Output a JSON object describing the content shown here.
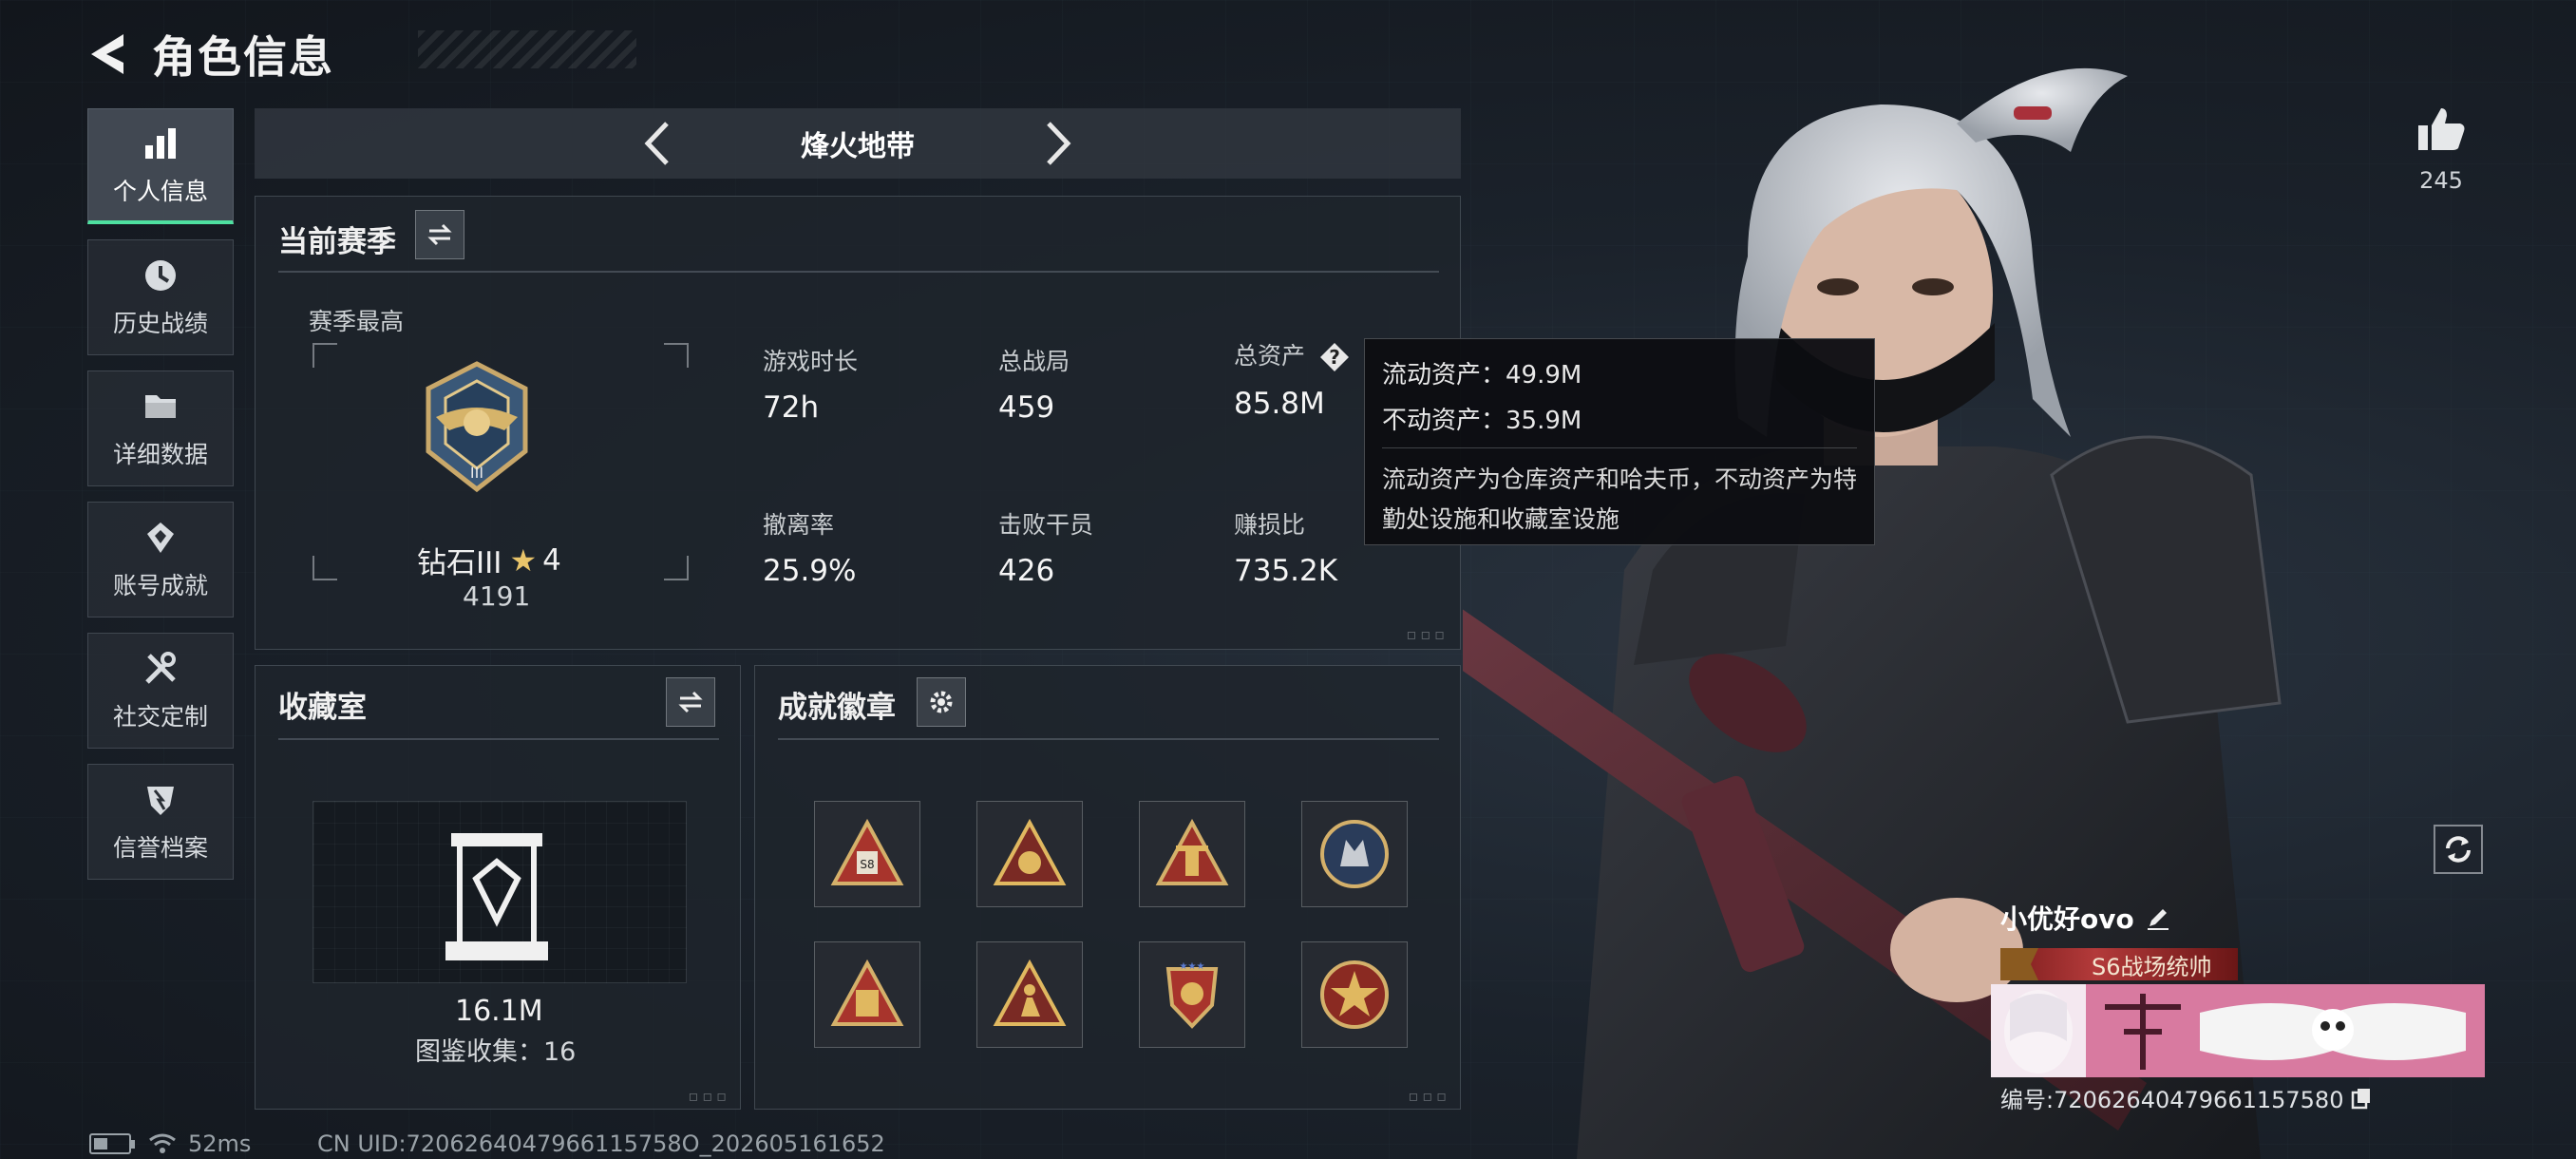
{
  "header": {
    "title": "角色信息"
  },
  "sidebar": {
    "items": [
      {
        "label": "个人信息",
        "icon": "bar-chart-icon",
        "active": true
      },
      {
        "label": "历史战绩",
        "icon": "history-icon",
        "active": false
      },
      {
        "label": "详细数据",
        "icon": "folder-icon",
        "active": false
      },
      {
        "label": "账号成就",
        "icon": "achievement-icon",
        "active": false
      },
      {
        "label": "社交定制",
        "icon": "tools-icon",
        "active": false
      },
      {
        "label": "信誉档案",
        "icon": "shield-icon",
        "active": false
      }
    ]
  },
  "mode": {
    "name": "烽火地带"
  },
  "season": {
    "title": "当前赛季",
    "best_label": "赛季最高",
    "rank_name": "钻石III",
    "rank_stars": "4",
    "rank_score": "4191",
    "stats": [
      {
        "key": "游戏时长",
        "value": "72h"
      },
      {
        "key": "总战局",
        "value": "459"
      },
      {
        "key": "总资产",
        "value": "85.8M"
      },
      {
        "key": "撤离率",
        "value": "25.9%"
      },
      {
        "key": "击败干员",
        "value": "426"
      },
      {
        "key": "赚损比",
        "value": "735.2K"
      }
    ]
  },
  "tooltip": {
    "line1": "流动资产：49.9M",
    "line2": "不动资产：35.9M",
    "desc": "流动资产为仓库资产和哈夫币，不动资产为特勤处设施和收藏室设施"
  },
  "vault": {
    "title": "收藏室",
    "value": "16.1M",
    "count": "图鉴收集：16"
  },
  "badges": {
    "title": "成就徽章",
    "items": [
      "badge-s8-triangle",
      "badge-gold-triangle",
      "badge-tower-triangle",
      "badge-wolf-round",
      "badge-box-triangle",
      "badge-figure-triangle",
      "badge-shield-stars",
      "badge-star-round"
    ]
  },
  "status": {
    "ping": "52ms",
    "uid": "CN UID:7206264047966115758O_202605161652"
  },
  "social": {
    "likes": "245"
  },
  "player": {
    "name": "小优好ovo",
    "title": "S6战场统帅",
    "id": "编号:72062640479661157580"
  },
  "colors": {
    "accent": "#4ee0a0",
    "tag_red": "#b33a3a",
    "star": "#e8c46a"
  }
}
